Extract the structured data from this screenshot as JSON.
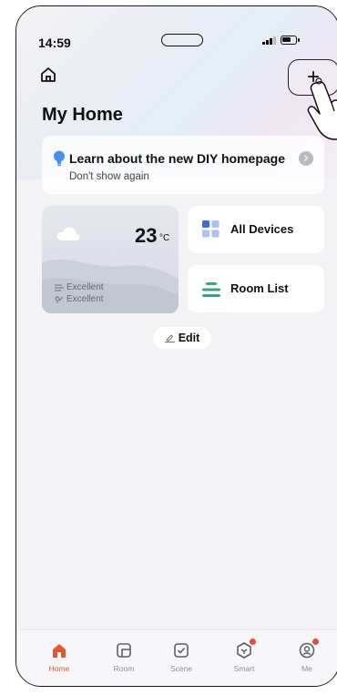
{
  "status_bar": {
    "time": "14:59"
  },
  "header": {
    "title": "My Home",
    "add_label": "+"
  },
  "banner": {
    "title": "Learn about the new DIY homepage",
    "subtitle": "Don't show again"
  },
  "weather": {
    "temperature": "23",
    "unit": "°C",
    "air_quality": "Excellent",
    "humidity": "Excellent"
  },
  "tiles": {
    "all_devices": "All Devices",
    "room_list": "Room List"
  },
  "edit_label": "Edit",
  "tabs": [
    {
      "label": "Home",
      "icon": "home-icon",
      "active": true
    },
    {
      "label": "Room",
      "icon": "room-icon"
    },
    {
      "label": "Scene",
      "icon": "scene-icon"
    },
    {
      "label": "Smart",
      "icon": "smart-icon",
      "badge": true
    },
    {
      "label": "Me",
      "icon": "me-icon",
      "badge": true
    }
  ],
  "colors": {
    "accent": "#e4572e",
    "badge": "#e84b3a",
    "bulb": "#4b8df0",
    "list_icon": "#3aa37c"
  }
}
